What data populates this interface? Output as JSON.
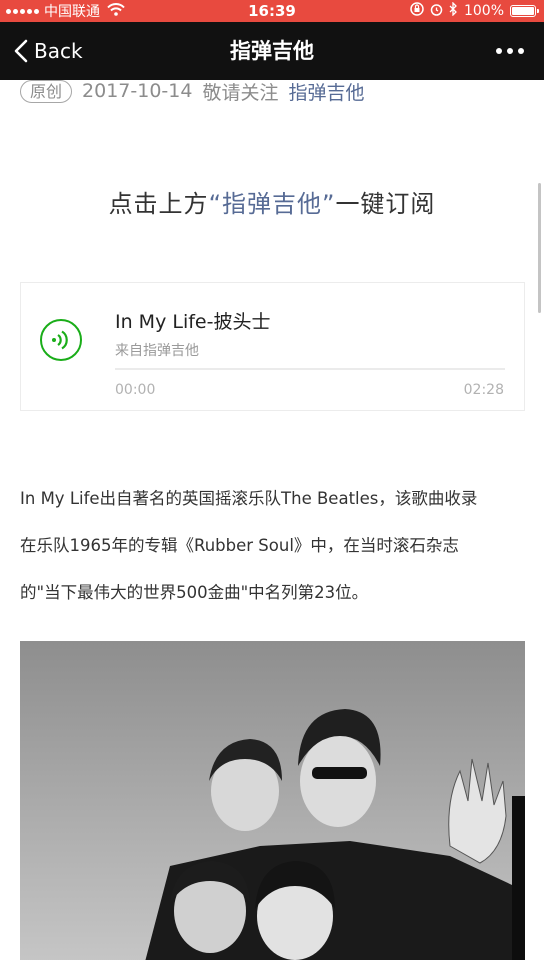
{
  "status_bar": {
    "carrier": "中国联通",
    "time": "16:39",
    "battery": "100%"
  },
  "nav": {
    "back_label": "Back",
    "title": "指弹吉他"
  },
  "article": {
    "original_tag": "原创",
    "date": "2017-10-14",
    "author": "敬请关注",
    "account": "指弹吉他",
    "subscribe_prefix": "点击上方",
    "subscribe_open_quote": "“",
    "subscribe_link": "指弹吉他",
    "subscribe_close_quote": "”",
    "subscribe_suffix": "一键订阅",
    "audio": {
      "title": "In My Life-披头士",
      "source": "来自指弹吉他",
      "current_time": "00:00",
      "duration": "02:28",
      "progress": 0
    },
    "paragraph_lines": [
      "In My Life出自著名的英国摇滚乐队The Beatles，该歌曲收录",
      "在乐队1965年的专辑《Rubber Soul》中，在当时滚石杂志",
      "的\"当下最伟大的世界500金曲\"中名列第23位。"
    ]
  },
  "colors": {
    "status_bar": "#e84a3f",
    "nav_bar": "#111111",
    "link": "#576b95",
    "play_green": "#1aad19"
  },
  "icons": {
    "back": "chevron-left-icon",
    "more": "more-dots-icon",
    "play": "audio-wave-icon"
  }
}
